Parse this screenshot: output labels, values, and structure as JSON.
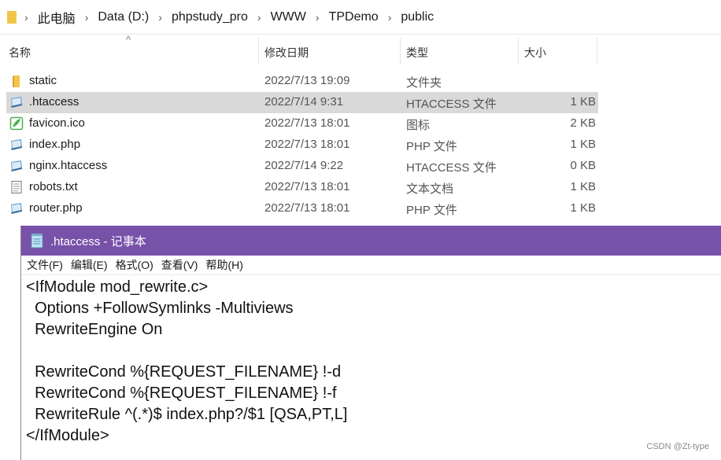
{
  "explorer": {
    "breadcrumb": [
      "此电脑",
      "Data (D:)",
      "phpstudy_pro",
      "WWW",
      "TPDemo",
      "public"
    ],
    "breadcrumb_separator": "›",
    "columns": {
      "name": "名称",
      "date": "修改日期",
      "type": "类型",
      "size": "大小"
    },
    "sort_caret": "^",
    "files": [
      {
        "name": "static",
        "date": "2022/7/13 19:09",
        "type": "文件夹",
        "size": "",
        "icon": "folder-icon"
      },
      {
        "name": ".htaccess",
        "date": "2022/7/14 9:31",
        "type": "HTACCESS 文件",
        "size": "1 KB",
        "icon": "htaccess-file-icon",
        "selected": true
      },
      {
        "name": "favicon.ico",
        "date": "2022/7/13 18:01",
        "type": "图标",
        "size": "2 KB",
        "icon": "image-file-icon"
      },
      {
        "name": "index.php",
        "date": "2022/7/13 18:01",
        "type": "PHP 文件",
        "size": "1 KB",
        "icon": "php-file-icon"
      },
      {
        "name": "nginx.htaccess",
        "date": "2022/7/14 9:22",
        "type": "HTACCESS 文件",
        "size": "0 KB",
        "icon": "htaccess-file-icon"
      },
      {
        "name": "robots.txt",
        "date": "2022/7/13 18:01",
        "type": "文本文档",
        "size": "1 KB",
        "icon": "text-file-icon"
      },
      {
        "name": "router.php",
        "date": "2022/7/13 18:01",
        "type": "PHP 文件",
        "size": "1 KB",
        "icon": "php-file-icon"
      }
    ]
  },
  "notepad": {
    "title": ".htaccess - 记事本",
    "menu": [
      "文件(F)",
      "编辑(E)",
      "格式(O)",
      "查看(V)",
      "帮助(H)"
    ],
    "lines": [
      "<IfModule mod_rewrite.c>",
      "  Options +FollowSymlinks -Multiviews",
      "  RewriteEngine On",
      "",
      "  RewriteCond %{REQUEST_FILENAME} !-d",
      "  RewriteCond %{REQUEST_FILENAME} !-f",
      "  RewriteRule ^(.*)$ index.php?/$1 [QSA,PT,L]",
      "</IfModule>"
    ]
  },
  "watermark": "CSDN @Zt-type",
  "colors": {
    "notepad_titlebar": "#7851a9",
    "selection": "#d9d9d9",
    "folder": "#f2c54a"
  }
}
